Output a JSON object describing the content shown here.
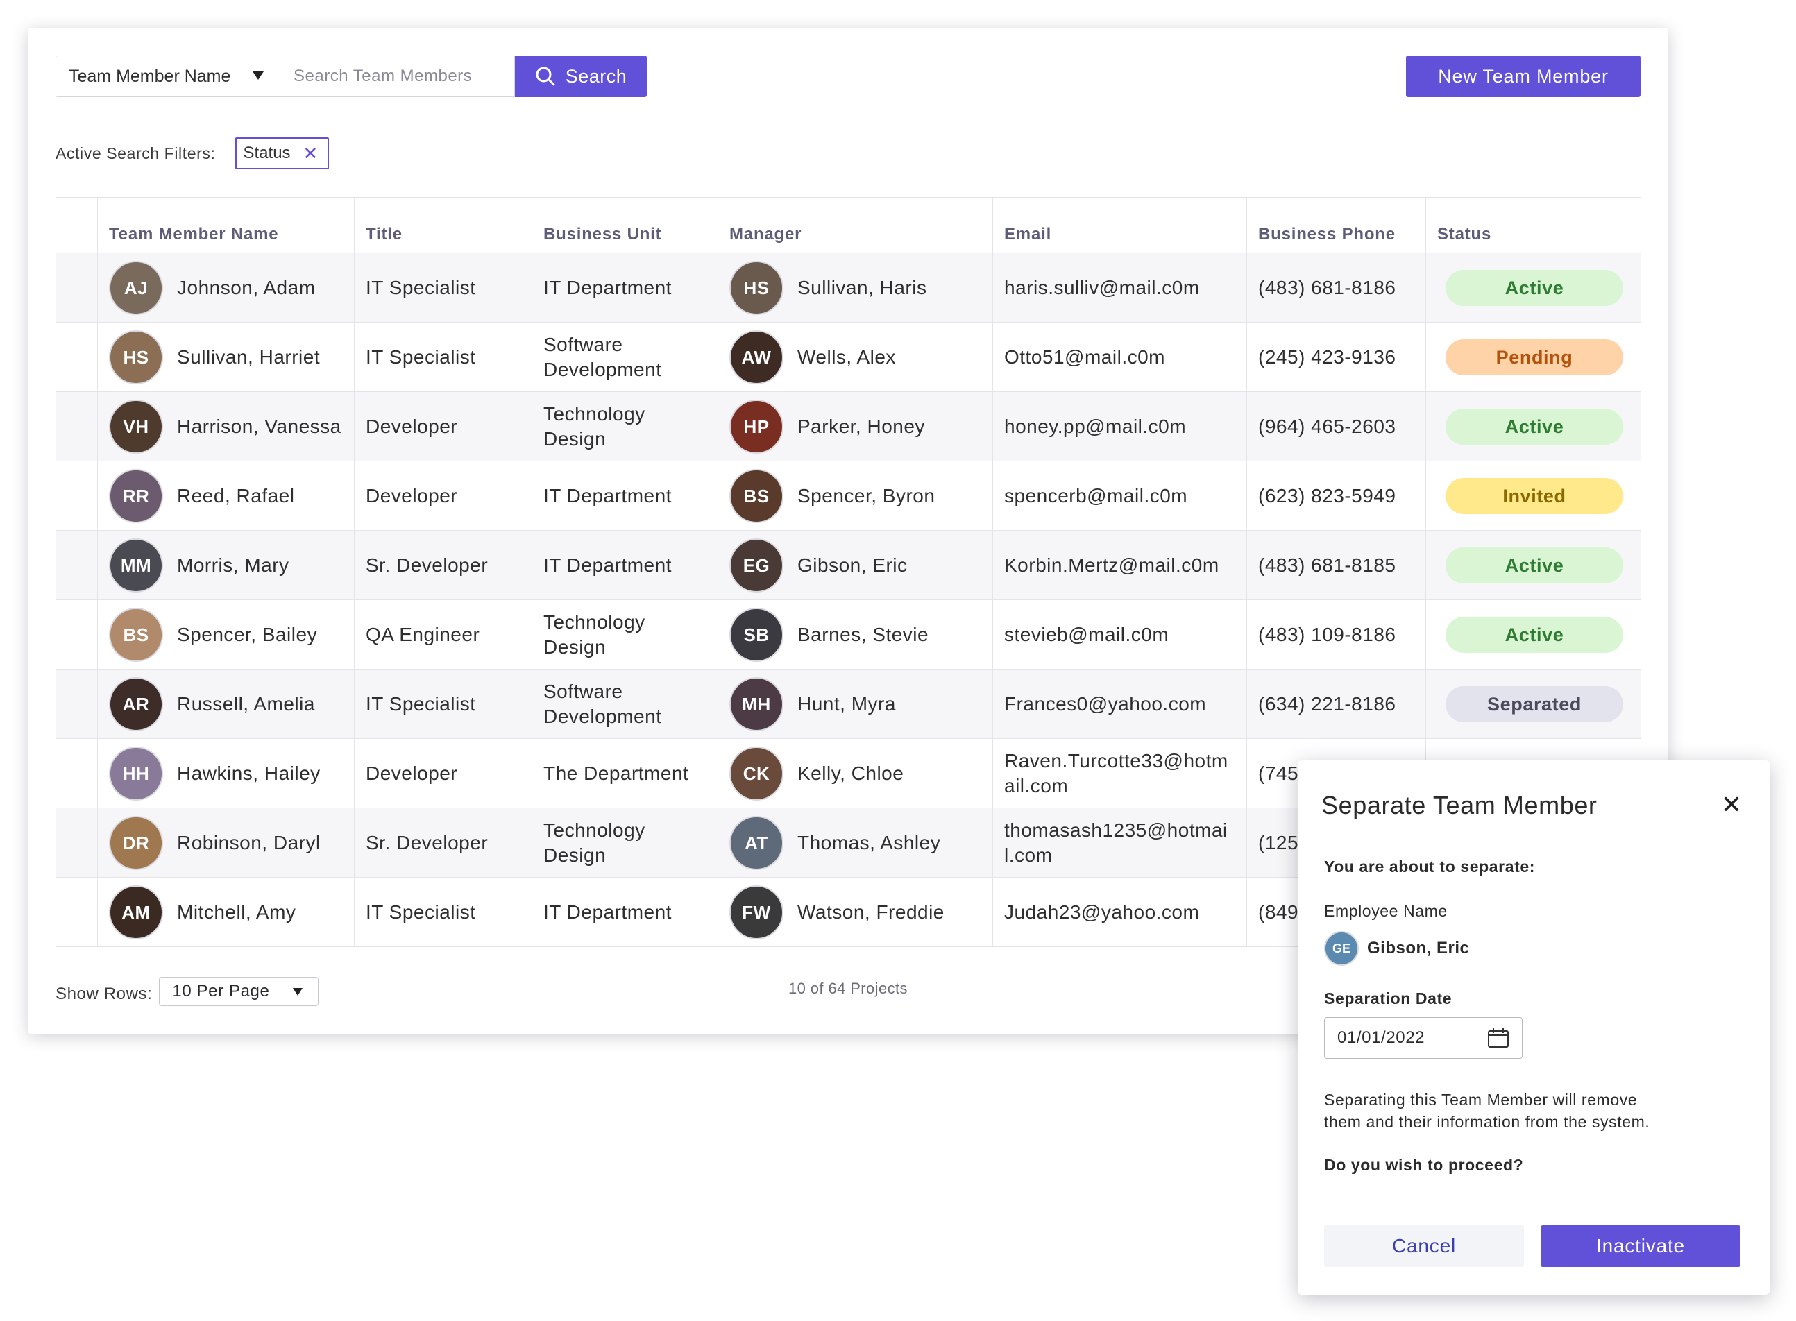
{
  "toolbar": {
    "search_field_select": "Team Member Name",
    "search_placeholder": "Search Team Members",
    "search_button": "Search",
    "new_button": "New Team Member"
  },
  "filters": {
    "label": "Active Search Filters:",
    "chips": [
      {
        "label": "Status"
      }
    ]
  },
  "table": {
    "columns": [
      "Team Member Name",
      "Title",
      "Business Unit",
      "Manager",
      "Email",
      "Business Phone",
      "Status"
    ],
    "rows": [
      {
        "name": "Johnson, Adam",
        "title": "IT Specialist",
        "unit": "IT Department",
        "manager": "Sullivan, Haris",
        "email": "haris.sulliv@mail.c0m",
        "phone": "(483) 681-8186",
        "status": "Active"
      },
      {
        "name": "Sullivan, Harriet",
        "title": "IT Specialist",
        "unit": "Software Development",
        "manager": "Wells, Alex",
        "email": "Otto51@mail.c0m",
        "phone": "(245) 423-9136",
        "status": "Pending"
      },
      {
        "name": "Harrison, Vanessa",
        "title": "Developer",
        "unit": "Technology Design",
        "manager": "Parker, Honey",
        "email": "honey.pp@mail.c0m",
        "phone": "(964) 465-2603",
        "status": "Active"
      },
      {
        "name": "Reed, Rafael",
        "title": "Developer",
        "unit": "IT Department",
        "manager": "Spencer, Byron",
        "email": "spencerb@mail.c0m",
        "phone": "(623) 823-5949",
        "status": "Invited"
      },
      {
        "name": "Morris, Mary",
        "title": "Sr. Developer",
        "unit": "IT Department",
        "manager": "Gibson, Eric",
        "email": "Korbin.Mertz@mail.c0m",
        "phone": "(483) 681-8185",
        "status": "Active"
      },
      {
        "name": "Spencer, Bailey",
        "title": "QA Engineer",
        "unit": "Technology Design",
        "manager": "Barnes, Stevie",
        "email": "stevieb@mail.c0m",
        "phone": "(483) 109-8186",
        "status": "Active"
      },
      {
        "name": "Russell, Amelia",
        "title": "IT Specialist",
        "unit": "Software Development",
        "manager": "Hunt, Myra",
        "email": "Frances0@yahoo.com",
        "phone": "(634) 221-8186",
        "status": "Separated"
      },
      {
        "name": "Hawkins, Hailey",
        "title": "Developer",
        "unit": "The Department",
        "manager": "Kelly, Chloe",
        "email": "Raven.Turcotte33@hotmail.com",
        "phone": "(745",
        "status": ""
      },
      {
        "name": "Robinson, Daryl",
        "title": "Sr. Developer",
        "unit": "Technology Design",
        "manager": "Thomas, Ashley",
        "email": "thomasash1235@hotmail.com",
        "phone": "(125",
        "status": ""
      },
      {
        "name": "Mitchell, Amy",
        "title": "IT Specialist",
        "unit": "IT Department",
        "manager": "Watson, Freddie",
        "email": "Judah23@yahoo.com",
        "phone": "(849",
        "status": ""
      }
    ]
  },
  "footer": {
    "rows_label": "Show Rows:",
    "rows_value": "10 Per Page",
    "count": "10 of 64 Projects"
  },
  "modal": {
    "title": "Separate Team Member",
    "intro": "You are about to separate:",
    "employee_label": "Employee Name",
    "employee_name": "Gibson, Eric",
    "date_label": "Separation Date",
    "date_value": "01/01/2022",
    "warning_line1": "Separating this Team Member will remove",
    "warning_line2": "them and their information from the system.",
    "question": "Do you wish to proceed?",
    "cancel": "Cancel",
    "confirm": "Inactivate"
  },
  "colors": {
    "accent": "#6150d8",
    "active_bg": "#d9f5d4",
    "pending_bg": "#ffd3a8",
    "invited_bg": "#ffe98a",
    "separated_bg": "#e3e3ee"
  },
  "icons": {
    "search": "search-icon",
    "close_chip": "close-icon",
    "close_modal": "close-icon",
    "calendar": "calendar-icon",
    "dropdown": "caret-down-icon",
    "avatar": "avatar-photo"
  }
}
